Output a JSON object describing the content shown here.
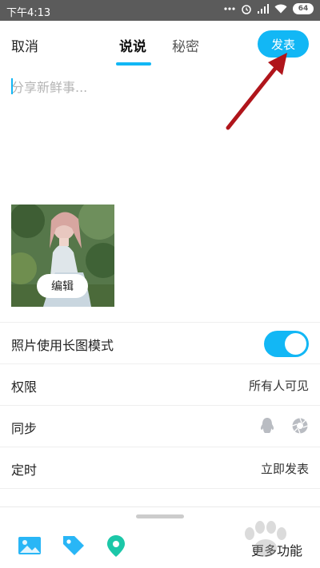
{
  "status_bar": {
    "time": "下午4:13",
    "battery": "64"
  },
  "header": {
    "cancel_label": "取消",
    "tabs": [
      {
        "label": "说说"
      },
      {
        "label": "秘密"
      }
    ],
    "publish_label": "发表"
  },
  "compose": {
    "placeholder": "分享新鲜事..."
  },
  "photo": {
    "edit_label": "编辑"
  },
  "settings": {
    "long_image": {
      "label": "照片使用长图模式",
      "enabled": true
    },
    "permission": {
      "label": "权限",
      "value": "所有人可见"
    },
    "sync": {
      "label": "同步"
    },
    "schedule": {
      "label": "定时",
      "value": "立即发表"
    }
  },
  "toolbar": {
    "more_label": "更多功能"
  },
  "colors": {
    "accent": "#12b7f5",
    "arrow": "#b0151b"
  }
}
